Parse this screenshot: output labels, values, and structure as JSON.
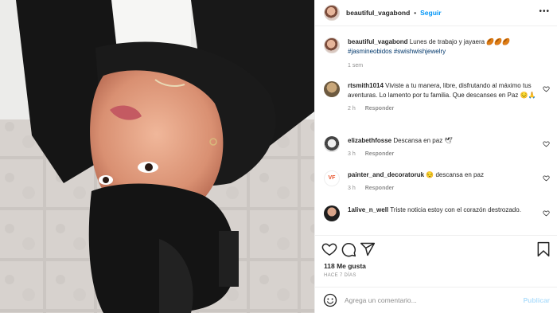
{
  "post": {
    "username": "beautiful_vagabond",
    "follow_label": "Seguir",
    "more_icon": "more-horizontal-icon"
  },
  "caption": {
    "username": "beautiful_vagabond",
    "text": "Lunes de trabajo y jayaera",
    "emoji": "🏉🏉🏉",
    "hashtags": "#jasmineobidos #swishwishjewelry",
    "time": "1 sem"
  },
  "comments": [
    {
      "username": "rtsmith1014",
      "text": "Viviste a tu manera, libre, disfrutando al máximo tus aventuras. Lo lamento por tu familia. Que descanses en Paz 😔🙏",
      "time": "2 h",
      "reply_label": "Responder"
    },
    {
      "username": "elizabethfosse",
      "text": "Descansa en paz 🕊",
      "time": "3 h",
      "reply_label": "Responder"
    },
    {
      "username": "painter_and_decoratoruk",
      "text": "😔 descansa en paz",
      "time": "3 h",
      "reply_label": "Responder",
      "avatar_badge": "VF"
    },
    {
      "username": "1alive_n_well",
      "text": "Triste noticia estoy con el corazón destrozado.",
      "time": "",
      "reply_label": ""
    }
  ],
  "actions": {
    "icons": [
      "heart-icon",
      "comment-icon",
      "share-icon",
      "bookmark-icon"
    ],
    "likes": "118 Me gusta",
    "posted_ago": "HACE 7 DÍAS"
  },
  "add_comment": {
    "placeholder": "Agrega un comentario...",
    "post_label": "Publicar",
    "emoji_icon": "smiley-icon"
  },
  "colors": {
    "link": "#0095f6",
    "hashtag": "#00376b",
    "muted": "#8e8e8e",
    "post_disabled": "#b2dffc"
  }
}
